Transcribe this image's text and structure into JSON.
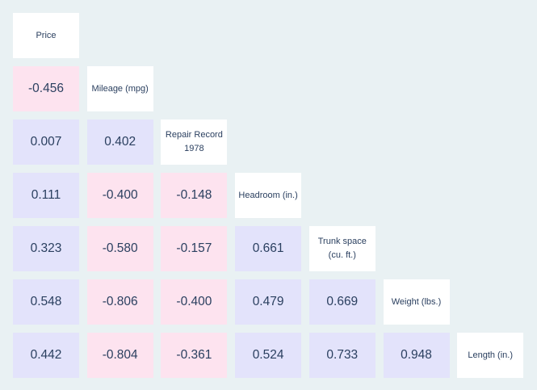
{
  "chart_data": {
    "type": "heatmap",
    "subtype": "lower-triangular correlation matrix",
    "variables": [
      "Price",
      "Mileage (mpg)",
      "Repair Record 1978",
      "Headroom (in.)",
      "Trunk space (cu. ft.)",
      "Weight (lbs.)",
      "Length (in.)"
    ],
    "values": [
      [
        null
      ],
      [
        -0.456,
        null
      ],
      [
        0.007,
        0.402,
        null
      ],
      [
        0.111,
        -0.4,
        -0.148,
        null
      ],
      [
        0.323,
        -0.58,
        -0.157,
        0.661,
        null
      ],
      [
        0.548,
        -0.806,
        -0.4,
        0.479,
        0.669,
        null
      ],
      [
        0.442,
        -0.804,
        -0.361,
        0.524,
        0.733,
        0.948,
        null
      ]
    ],
    "value_labels": [
      [],
      [
        "-0.456"
      ],
      [
        "0.007",
        "0.402"
      ],
      [
        "0.111",
        "-0.400",
        "-0.148"
      ],
      [
        "0.323",
        "-0.580",
        "-0.157",
        "0.661"
      ],
      [
        "0.548",
        "-0.806",
        "-0.400",
        "0.479",
        "0.669"
      ],
      [
        "0.442",
        "-0.804",
        "-0.361",
        "0.524",
        "0.733",
        "0.948"
      ]
    ],
    "colors": {
      "background": "#e9f1f3",
      "label_cell": "#ffffff",
      "positive": "#e3e3fb",
      "negative": "#fde3ef",
      "text": "#2a3f5f"
    }
  }
}
